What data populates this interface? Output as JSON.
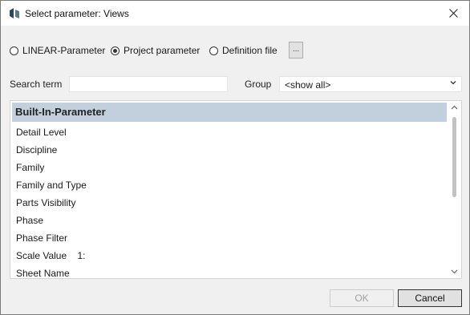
{
  "window": {
    "title": "Select parameter: Views"
  },
  "source_options": [
    {
      "label": "LINEAR-Parameter",
      "selected": false
    },
    {
      "label": "Project parameter",
      "selected": true
    },
    {
      "label": "Definition file",
      "selected": false
    }
  ],
  "browse_label": "...",
  "search": {
    "label": "Search term",
    "value": ""
  },
  "group": {
    "label": "Group",
    "value": "<show all>"
  },
  "list": {
    "header": "Built-In-Parameter",
    "items": [
      "Detail Level",
      "Discipline",
      "Family",
      "Family and Type",
      "Parts Visibility",
      "Phase",
      "Phase Filter",
      "Scale Value    1:",
      "Sheet Name"
    ]
  },
  "buttons": {
    "ok": "OK",
    "cancel": "Cancel"
  }
}
